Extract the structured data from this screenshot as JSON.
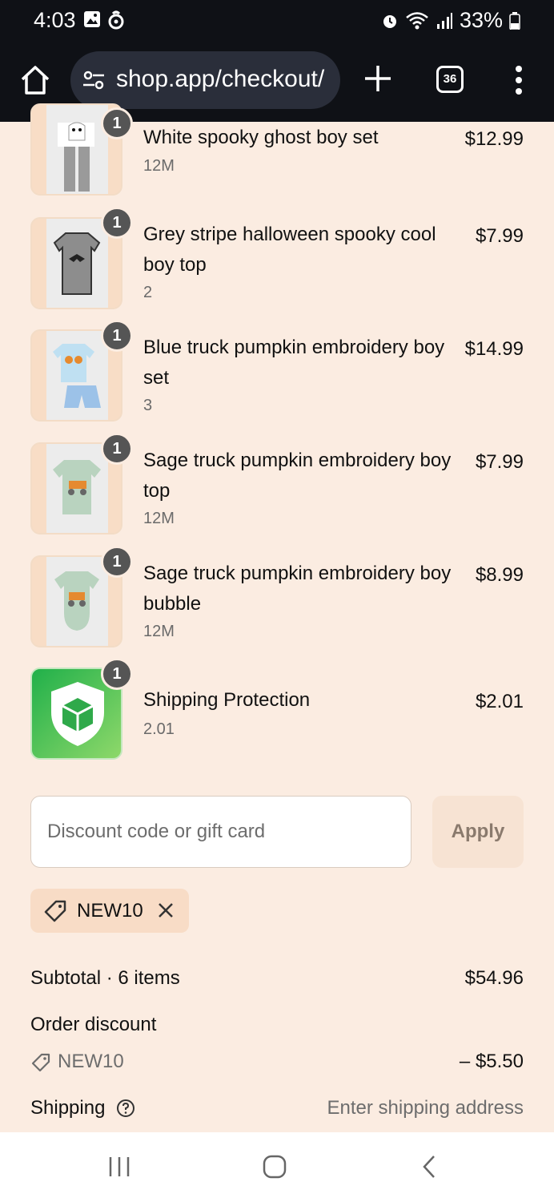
{
  "status_bar": {
    "time": "4:03",
    "battery": "33%"
  },
  "browser": {
    "url": "shop.app/checkout/",
    "tab_count": "36"
  },
  "items": [
    {
      "title": "White spooky ghost boy set",
      "variant": "12M",
      "price": "$12.99",
      "quantity": "1"
    },
    {
      "title": "Grey stripe halloween spooky cool boy top",
      "variant": "2",
      "price": "$7.99",
      "quantity": "1"
    },
    {
      "title": "Blue truck pumpkin embroidery boy set",
      "variant": "3",
      "price": "$14.99",
      "quantity": "1"
    },
    {
      "title": "Sage truck pumpkin embroidery boy top",
      "variant": "12M",
      "price": "$7.99",
      "quantity": "1"
    },
    {
      "title": "Sage truck pumpkin embroidery boy bubble",
      "variant": "12M",
      "price": "$8.99",
      "quantity": "1"
    },
    {
      "title": "Shipping Protection",
      "variant": "2.01",
      "price": "$2.01",
      "quantity": "1"
    }
  ],
  "discount": {
    "placeholder": "Discount code or gift card",
    "apply_label": "Apply",
    "applied_code": "NEW10"
  },
  "summary": {
    "subtotal_label": "Subtotal · 6 items",
    "subtotal_value": "$54.96",
    "order_discount_label": "Order discount",
    "discount_code": "NEW10",
    "discount_value": "– $5.50",
    "shipping_label": "Shipping",
    "shipping_value": "Enter shipping address"
  },
  "colors": {
    "background": "#fbece1",
    "shipping_protection_green": "#3cb64a",
    "badge": "#555555"
  }
}
